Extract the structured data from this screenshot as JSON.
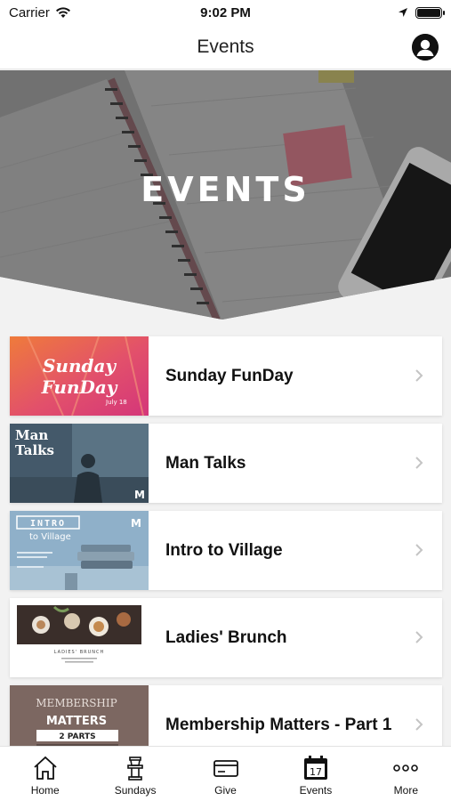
{
  "status": {
    "carrier": "Carrier",
    "time": "9:02 PM"
  },
  "nav": {
    "title": "Events"
  },
  "hero": {
    "title": "EVENTS"
  },
  "events": [
    {
      "name": "Sunday FunDay",
      "thumb_text": "Sunday FunDay",
      "thumb_sub": "July 18"
    },
    {
      "name": "Man Talks",
      "thumb_text": "Man Talks"
    },
    {
      "name": "Intro to Village",
      "thumb_text": "INTRO",
      "thumb_text2": "to Village"
    },
    {
      "name": "Ladies' Brunch",
      "thumb_text": "LADIES' BRUNCH"
    },
    {
      "name": "Membership Matters - Part 1",
      "thumb_text": "MEMBERSHIP",
      "thumb_text2": "MATTERS",
      "thumb_text3": "2 PARTS"
    }
  ],
  "tabs": [
    {
      "label": "Home",
      "icon": "home-icon"
    },
    {
      "label": "Sundays",
      "icon": "pulpit-icon"
    },
    {
      "label": "Give",
      "icon": "card-icon"
    },
    {
      "label": "Events",
      "icon": "calendar-icon",
      "day": "17"
    },
    {
      "label": "More",
      "icon": "more-icon"
    }
  ],
  "colors": {
    "accent": "#111111",
    "card": "#ffffff",
    "background": "#f2f2f2"
  }
}
